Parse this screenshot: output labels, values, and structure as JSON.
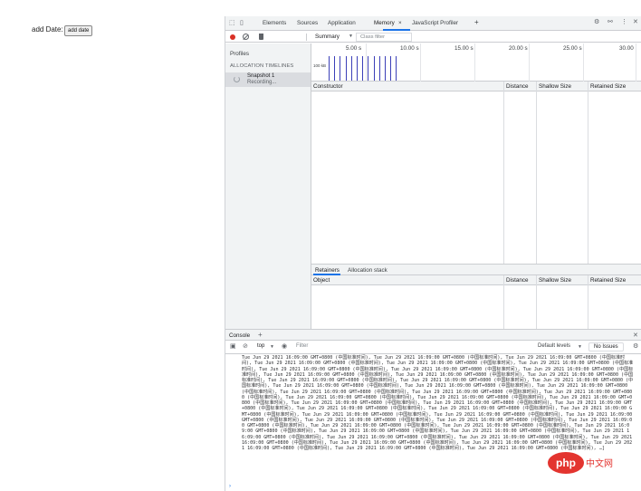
{
  "page": {
    "add_label": "add Date:",
    "add_button": "add date"
  },
  "devtools": {
    "tabs": [
      "Elements",
      "Sources",
      "Application",
      "Memory",
      "JavaScript Profiler"
    ],
    "close_tab_symbol": "×",
    "add_tab_symbol": "+",
    "toolbar": {
      "view_select": "Summary",
      "class_filter_placeholder": "Class filter"
    },
    "sidebar": {
      "profiles_label": "Profiles",
      "section_label": "ALLOCATION TIMELINES",
      "snapshot_name": "Snapshot 1",
      "snapshot_status": "Recording..."
    },
    "timeline": {
      "ticks": [
        "5.00 s",
        "10.00 s",
        "15.00 s",
        "20.00 s",
        "25.00 s",
        "30.00"
      ],
      "size_label": "100 kB",
      "allocation_bars": 13
    },
    "table_columns": [
      "Constructor",
      "Distance",
      "Shallow Size",
      "Retained Size"
    ],
    "bottom_tabs": [
      "Retainers",
      "Allocation stack"
    ],
    "retainer_columns": [
      "Object",
      "Distance",
      "Shallow Size",
      "Retained Size"
    ]
  },
  "console": {
    "tab_label": "Console",
    "context_select": "top",
    "filter_placeholder": "Filter",
    "levels_select": "Default levels",
    "issues_button": "No Issues",
    "log_entry": "Tue Jun 29 2021 16:09:00 GMT+0800 (中国标准时间)",
    "log_repeat": 50,
    "log_tail": ", …]",
    "prompt_symbol": "›"
  },
  "watermark": {
    "text": "php",
    "suffix": "中文网",
    "color": "#e3342f"
  }
}
